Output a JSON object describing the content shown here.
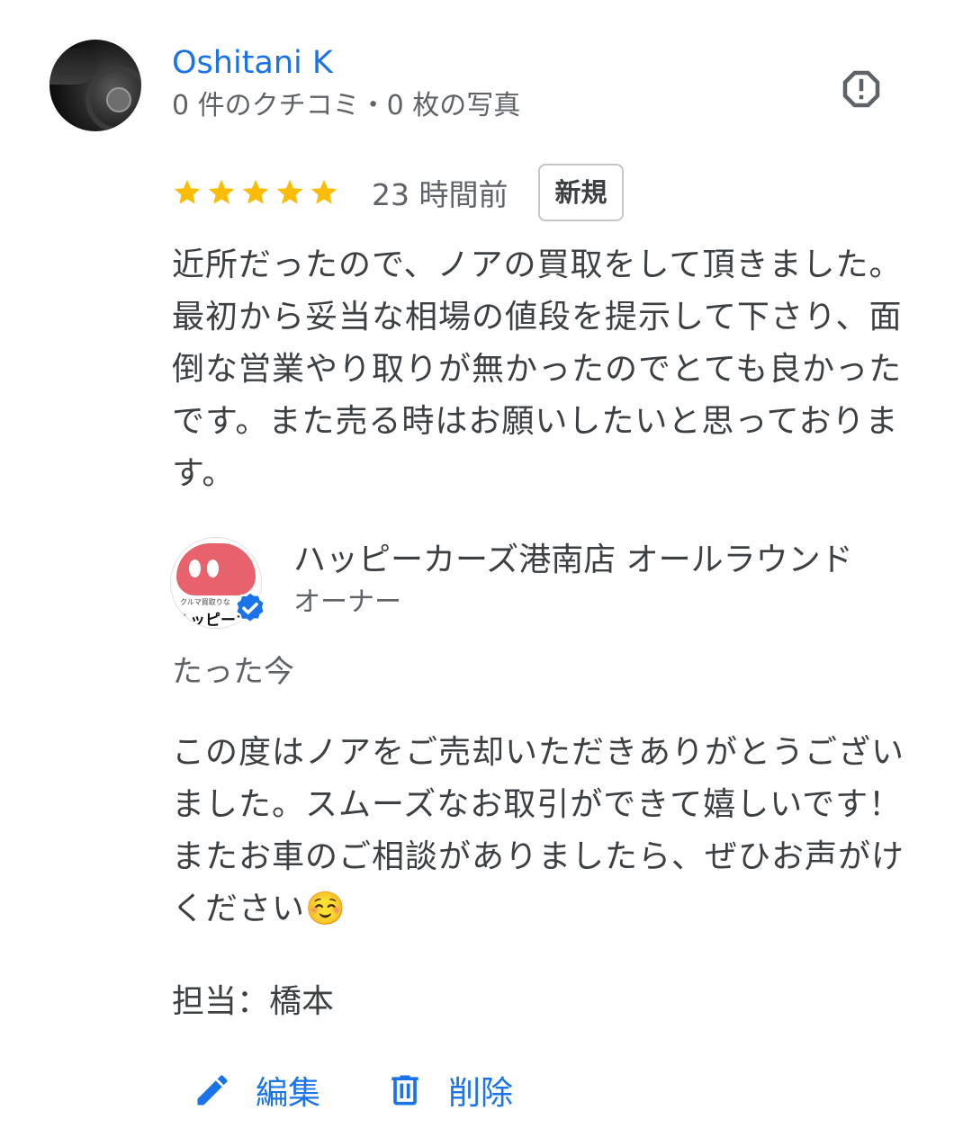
{
  "review": {
    "reviewer_name": "Oshitani K",
    "reviewer_meta": "0 件のクチコミ・0 枚の写真",
    "rating": 5,
    "rating_max": 5,
    "time_ago": "23 時間前",
    "badge": "新規",
    "text": "近所だったので、ノアの買取をして頂きました。最初から妥当な相場の値段を提示して下さり、面倒な営業やり取りが無かったのでとても良かったです。また売る時はお願いしたいと思っております。",
    "report_icon": "report-icon"
  },
  "owner_reply": {
    "owner_name": "ハッピーカーズ港南店 オールラウンド",
    "owner_role": "オーナー",
    "avatar_small_text": "クルマ買取りな",
    "avatar_logo_text": "ハッピーカ",
    "verified_icon": "verified-check-icon",
    "time": "たった今",
    "text": "この度はノアをご売却いただきありがとうございました。スムーズなお取引ができて嬉しいです！またお車のご相談がありましたら、ぜひお声がけください☺️",
    "signature": "担当：橋本"
  },
  "actions": {
    "edit_label": "編集",
    "delete_label": "削除"
  },
  "colors": {
    "accent": "#1a73e8",
    "star": "#fbbc04",
    "secondary_text": "#5f6368",
    "body_text": "#3c4043",
    "logo_pink": "#e8626e"
  }
}
